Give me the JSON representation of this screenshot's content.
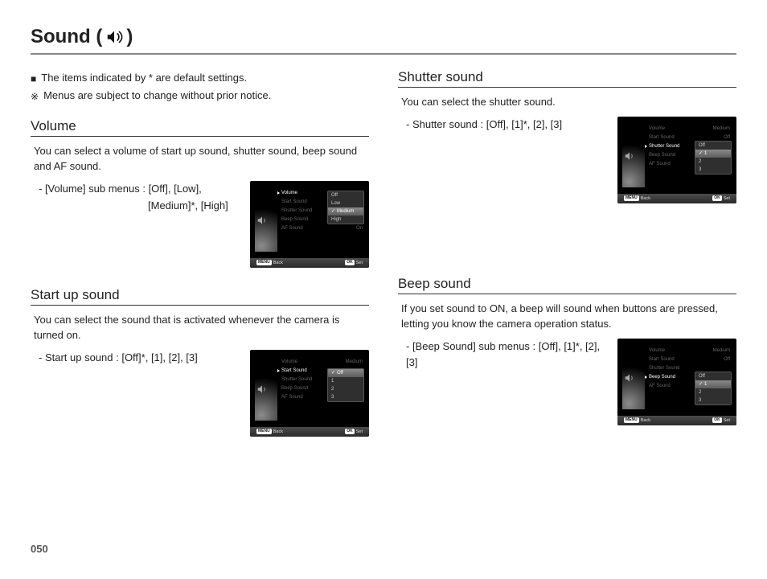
{
  "page_title_prefix": "Sound (",
  "page_title_suffix": ")",
  "page_number": "050",
  "notes": {
    "n1": "The items indicated by * are default settings.",
    "n2": "Menus are subject to change without prior notice."
  },
  "volume": {
    "title": "Volume",
    "body": "You can select a volume of start up sound, shutter sound, beep sound and AF sound.",
    "opt_line1": "- [Volume] sub menus : [Off], [Low],",
    "opt_line2": "[Medium]*, [High]"
  },
  "startup": {
    "title": "Start up sound",
    "body": "You can select the sound that is activated whenever the camera is turned on.",
    "opt": "- Start up sound : [Off]*, [1], [2], [3]"
  },
  "shutter": {
    "title": "Shutter sound",
    "body": "You can select the shutter sound.",
    "opt": "- Shutter sound : [Off], [1]*, [2], [3]"
  },
  "beep": {
    "title": "Beep sound",
    "body": "If you set sound to ON, a beep will sound when buttons are pressed, letting you know the camera operation status.",
    "opt": "- [Beep Sound] sub menus : [Off], [1]*, [2], [3]"
  },
  "menu_common": {
    "back_tag": "MENU",
    "back": "Back",
    "set_tag": "OK",
    "set": "Set",
    "items": {
      "volume": "Volume",
      "start": "Start Sound",
      "shutter": "Shutter Sound",
      "beep": "Beep Sound",
      "af": "AF Sound"
    },
    "right_vals": {
      "medium": "Medium",
      "off": "Off",
      "on": "On"
    }
  },
  "sub_volume": {
    "off": "Off",
    "low": "Low",
    "medium": "Medium",
    "high": "High"
  },
  "sub_num": {
    "off": "Off",
    "v1": "1",
    "v2": "2",
    "v3": "3"
  }
}
